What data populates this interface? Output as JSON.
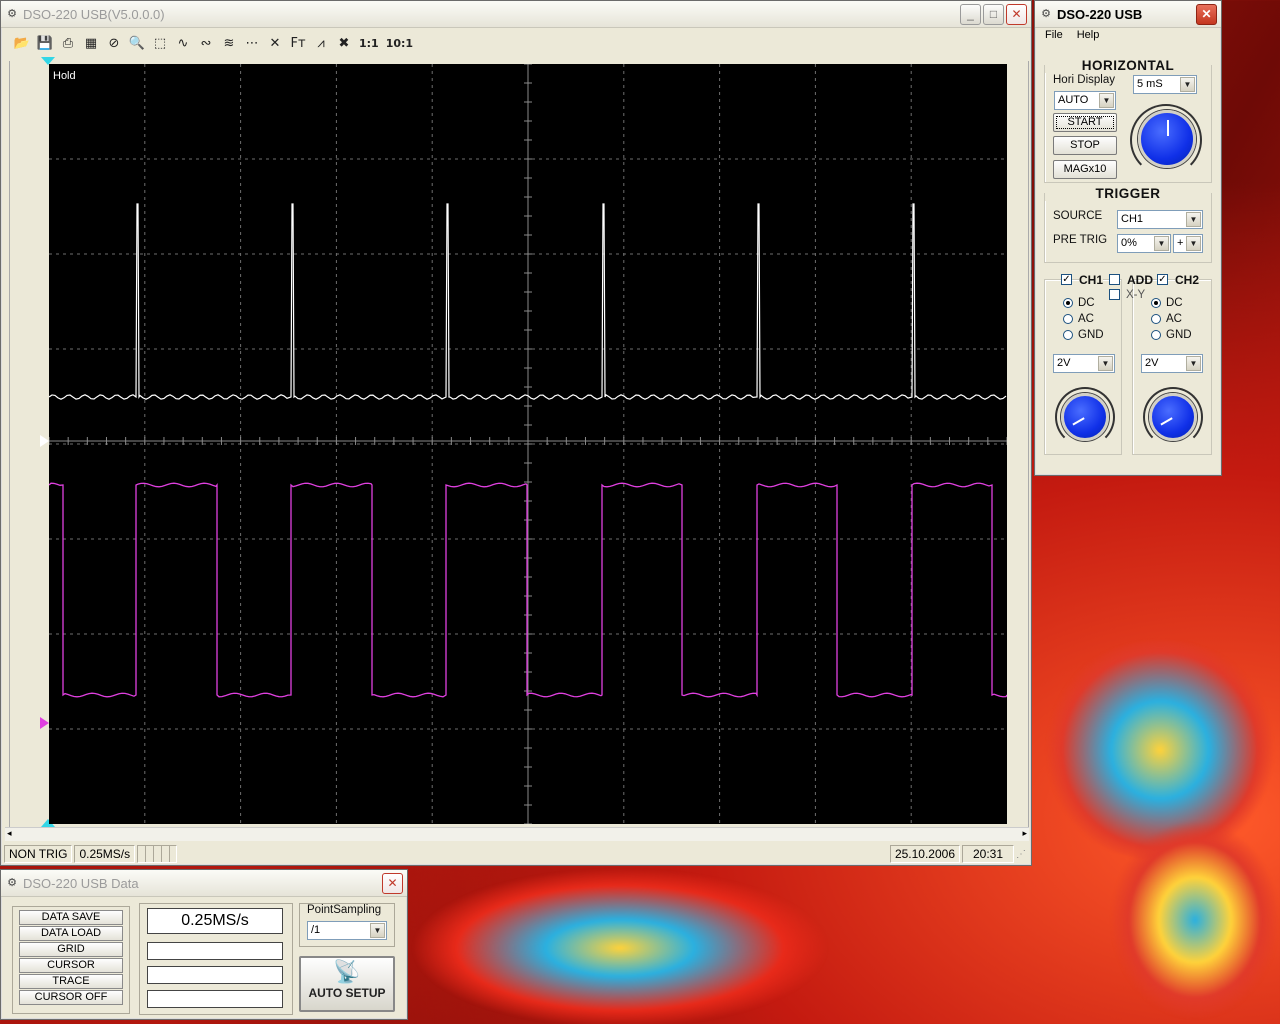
{
  "main_window": {
    "title": "DSO-220 USB(V5.0.0.0)",
    "controls": {
      "minimize": "_",
      "maximize": "□",
      "close": "✕"
    },
    "toolbar": [
      {
        "name": "open-icon",
        "glyph": "📂"
      },
      {
        "name": "save-icon",
        "glyph": "💾"
      },
      {
        "name": "print-icon",
        "glyph": "⎙"
      },
      {
        "name": "capture-icon",
        "glyph": "▦"
      },
      {
        "name": "stop-icon",
        "glyph": "⊘"
      },
      {
        "name": "zoom-icon",
        "glyph": "🔍"
      },
      {
        "name": "select-icon",
        "glyph": "⬚"
      },
      {
        "name": "wave1-icon",
        "glyph": "∿"
      },
      {
        "name": "wave2-icon",
        "glyph": "∾"
      },
      {
        "name": "wave3-icon",
        "glyph": "≋"
      },
      {
        "name": "dots-icon",
        "glyph": "⋯"
      },
      {
        "name": "cursor-icon",
        "glyph": "✕"
      },
      {
        "name": "fft-icon",
        "glyph": "Fᴛ"
      },
      {
        "name": "measure-icon",
        "glyph": "⩘"
      },
      {
        "name": "delete-icon",
        "glyph": "✖"
      }
    ],
    "ratio_buttons": [
      "1:1",
      "10:1"
    ],
    "scope": {
      "hold_label": "Hold"
    },
    "status": {
      "trigger": "NON TRIG",
      "rate": "0.25MS/s",
      "date": "25.10.2006",
      "time": "20:31"
    }
  },
  "control_window": {
    "title": "DSO-220 USB",
    "menu": [
      "File",
      "Help"
    ],
    "horizontal": {
      "title": "HORIZONTAL",
      "hori_display_label": "Hori Display",
      "timebase": "5 mS",
      "mode": "AUTO",
      "start": "START",
      "stop": "STOP",
      "mag": "MAGx10"
    },
    "trigger": {
      "title": "TRIGGER",
      "source_label": "SOURCE",
      "source": "CH1",
      "pretrig_label": "PRE TRIG",
      "pretrig": "0%",
      "slope": "+"
    },
    "channels": {
      "ch1_label": "CH1",
      "add_label": "ADD",
      "ch2_label": "CH2",
      "xy_label": "X-Y",
      "dc": "DC",
      "ac": "AC",
      "gnd": "GND",
      "ch1_volts": "2V",
      "ch2_volts": "2V"
    }
  },
  "data_window": {
    "title": "DSO-220 USB Data",
    "buttons": [
      "DATA SAVE",
      "DATA LOAD",
      "GRID",
      "CURSOR",
      "TRACE",
      "CURSOR OFF"
    ],
    "rate_display": "0.25MS/s",
    "point_sampling_label": "PointSampling",
    "point_sampling": "/1",
    "auto_setup": "AUTO SETUP"
  },
  "colors": {
    "ch1": "#ffffff",
    "ch2": "#e040e0",
    "grid": "#6e6e6e",
    "marker_cyan": "#33d6e6"
  }
}
